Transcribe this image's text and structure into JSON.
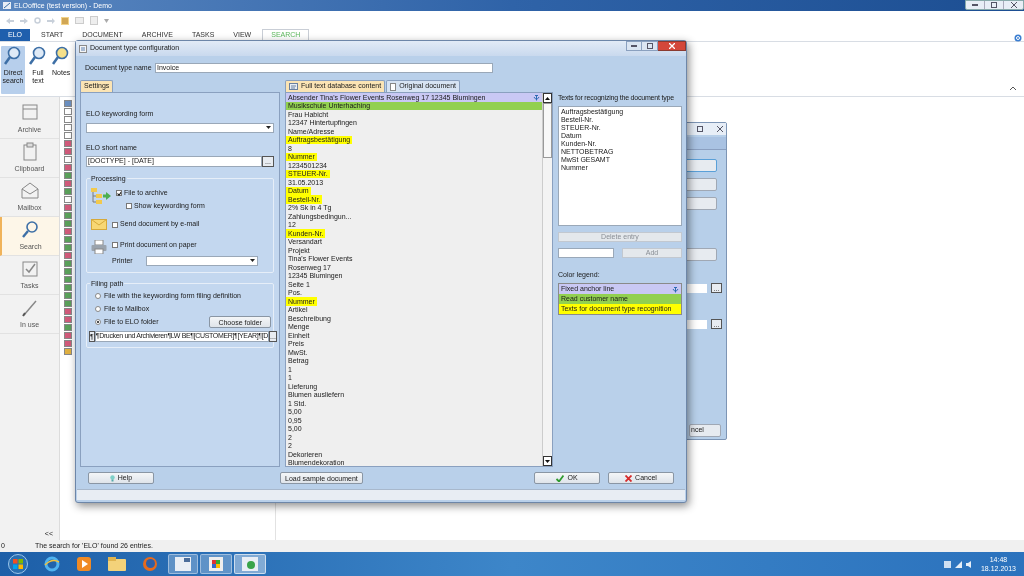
{
  "app": {
    "title": "ELOoffice (test version) - Demo",
    "ribbon_tabs": [
      {
        "label": "ELO",
        "selected": false,
        "kind": "menu"
      },
      {
        "label": "START",
        "selected": false,
        "kind": "tab"
      },
      {
        "label": "DOCUMENT",
        "selected": false,
        "kind": "tab"
      },
      {
        "label": "ARCHIVE",
        "selected": false,
        "kind": "tab"
      },
      {
        "label": "TASKS",
        "selected": false,
        "kind": "tab"
      },
      {
        "label": "VIEW",
        "selected": false,
        "kind": "tab"
      },
      {
        "label": "SEARCH",
        "selected": true,
        "kind": "tab"
      }
    ],
    "ribbon_buttons": [
      {
        "label": "Direct search",
        "selected": true
      },
      {
        "label": "Full text",
        "selected": false
      },
      {
        "label": "Notes",
        "selected": false
      }
    ],
    "nav": [
      {
        "label": "Archive",
        "selected": false
      },
      {
        "label": "Clipboard",
        "selected": false
      },
      {
        "label": "Mailbox",
        "selected": false
      },
      {
        "label": "Search",
        "selected": true
      },
      {
        "label": "Tasks",
        "selected": false
      },
      {
        "label": "In use",
        "selected": false
      }
    ],
    "collapse": "<<",
    "status_bar": {
      "count": "0",
      "message": "The search for 'ELO' found 26 entries."
    }
  },
  "dialog": {
    "title": "Document type configuration",
    "name_label": "Document type name",
    "name_value": "Invoice",
    "settings_tab": {
      "label": "Settings",
      "selected": true
    },
    "keywording_form": {
      "label": "ELO keywording form"
    },
    "short_name": {
      "label": "ELO short name",
      "value": "[DOCTYPE] - [DATE]",
      "button": "..."
    },
    "processing": {
      "title": "Processing",
      "options": [
        {
          "label": "File to archive",
          "checked": true
        },
        {
          "label": "Show keywording form",
          "checked": false
        },
        {
          "label": "Send document by e-mail",
          "checked": false
        },
        {
          "label": "Print document on paper",
          "checked": false
        }
      ],
      "printer_label": "Printer"
    },
    "filing_path": {
      "title": "Filing path",
      "options": [
        {
          "label": "File with the keywording form filing definition",
          "selected": false
        },
        {
          "label": "File to Mailbox",
          "selected": false
        },
        {
          "label": "File to ELO folder",
          "selected": true
        }
      ],
      "choose_button": "Choose folder",
      "pilcrow_button": "¶",
      "path_value": "¶Drucken und Archivieren¶LW BE¶[CUSTOMER]¶[YEAR]¶[D",
      "path_button": "..."
    },
    "content_tabs": [
      {
        "label": "Full text database content",
        "selected": true
      },
      {
        "label": "Original document",
        "selected": false
      }
    ],
    "content_lines": [
      {
        "text": "Absender Tina's Flower Events Rosenweg 17 12345 Blumingen",
        "kind": "anchor"
      },
      {
        "text": "Musikschule Unterhaching",
        "kind": "customer"
      },
      {
        "text": "Frau Habicht",
        "kind": "plain"
      },
      {
        "text": "12347 Hintertupfingen",
        "kind": "plain"
      },
      {
        "text": "Name/Adresse",
        "kind": "plain"
      },
      {
        "text": "Auftragsbestätigung",
        "kind": "recognition"
      },
      {
        "text": "8",
        "kind": "plain"
      },
      {
        "text": "Nummer",
        "kind": "recognition"
      },
      {
        "text": "1234501234",
        "kind": "plain"
      },
      {
        "text": "STEUER-Nr.",
        "kind": "recognition"
      },
      {
        "text": "31.05.2013",
        "kind": "plain"
      },
      {
        "text": "Datum",
        "kind": "recognition"
      },
      {
        "text": "Bestell-Nr.",
        "kind": "recognition"
      },
      {
        "text": "2% Sk in 4 Tg",
        "kind": "plain"
      },
      {
        "text": "Zahlungsbedingun...",
        "kind": "plain"
      },
      {
        "text": "12",
        "kind": "plain"
      },
      {
        "text": "Kunden-Nr.",
        "kind": "recognition"
      },
      {
        "text": "Versandart",
        "kind": "plain"
      },
      {
        "text": "Projekt",
        "kind": "plain"
      },
      {
        "text": "Tina's Flower Events",
        "kind": "plain"
      },
      {
        "text": "Rosenweg 17",
        "kind": "plain"
      },
      {
        "text": "12345 Blumingen",
        "kind": "plain"
      },
      {
        "text": "Seite 1",
        "kind": "plain"
      },
      {
        "text": "Pos.",
        "kind": "plain"
      },
      {
        "text": "Nummer",
        "kind": "recognition"
      },
      {
        "text": "Artikel",
        "kind": "plain"
      },
      {
        "text": "Beschreibung",
        "kind": "plain"
      },
      {
        "text": "Menge",
        "kind": "plain"
      },
      {
        "text": "Einheit",
        "kind": "plain"
      },
      {
        "text": "Preis",
        "kind": "plain"
      },
      {
        "text": "MwSt.",
        "kind": "plain"
      },
      {
        "text": "Betrag",
        "kind": "plain"
      },
      {
        "text": "1",
        "kind": "plain"
      },
      {
        "text": "1",
        "kind": "plain"
      },
      {
        "text": "Lieferung",
        "kind": "plain"
      },
      {
        "text": "Blumen ausliefern",
        "kind": "plain"
      },
      {
        "text": "1 Std.",
        "kind": "plain"
      },
      {
        "text": "5,00",
        "kind": "plain"
      },
      {
        "text": "0,95",
        "kind": "plain"
      },
      {
        "text": "5,00",
        "kind": "plain"
      },
      {
        "text": "2",
        "kind": "plain"
      },
      {
        "text": "2",
        "kind": "plain"
      },
      {
        "text": "Dekorieren",
        "kind": "plain"
      },
      {
        "text": "Blumendekoration",
        "kind": "plain"
      }
    ],
    "recognition": {
      "label": "Texts for recognizing the document type",
      "items": [
        "Auftragsbestätigung",
        "Bestell-Nr.",
        "STEUER-Nr.",
        "Datum",
        "Kunden-Nr.",
        "NETTOBETRAG",
        "MwSt GESAMT",
        "Nummer"
      ],
      "delete_button": "Delete entry",
      "add_button": "Add"
    },
    "legend": {
      "label": "Color legend:",
      "items": [
        {
          "text": "Fixed anchor line",
          "kind": "anchor",
          "color": "#c9c8f4"
        },
        {
          "text": "Read customer name",
          "kind": "customer",
          "color": "#92d050"
        },
        {
          "text": "Texts for document type recognition",
          "kind": "recognition",
          "color": "#ffff00"
        }
      ]
    },
    "buttons": {
      "help": "Help",
      "load": "Load sample document",
      "ok": "OK",
      "cancel": "Cancel"
    }
  },
  "background_dialog": {
    "ellipsis_buttons": [
      "...",
      "..."
    ],
    "button_text": "ncel"
  },
  "taskbar": {
    "time": "14:48",
    "date": "18.12.2013"
  }
}
